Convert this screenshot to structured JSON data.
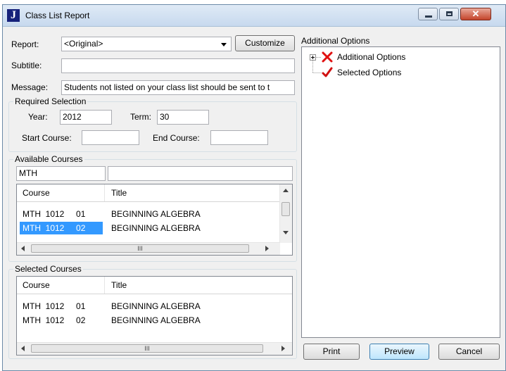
{
  "window": {
    "title": "Class List Report",
    "app_icon_letter": "J"
  },
  "form": {
    "report_label": "Report:",
    "report_value": "<Original>",
    "customize_label": "Customize",
    "subtitle_label": "Subtitle:",
    "subtitle_value": "",
    "message_label": "Message:",
    "message_value": "Students not listed on your class list should be sent to t"
  },
  "required_selection": {
    "title": "Required Selection",
    "year_label": "Year:",
    "year_value": "2012",
    "term_label": "Term:",
    "term_value": "30",
    "start_course_label": "Start Course:",
    "start_course_value": "",
    "end_course_label": "End Course:",
    "end_course_value": ""
  },
  "available_courses": {
    "title": "Available Courses",
    "filter_course": "MTH",
    "filter_title": "",
    "columns": [
      "Course",
      "Title"
    ],
    "rows": [
      {
        "course": "MTH  1012     01",
        "title": "BEGINNING ALGEBRA",
        "selected": false
      },
      {
        "course": "MTH  1012     02",
        "title": "BEGINNING ALGEBRA",
        "selected": true
      }
    ],
    "scroll_grip": "III"
  },
  "selected_courses": {
    "title": "Selected Courses",
    "columns": [
      "Course",
      "Title"
    ],
    "rows": [
      {
        "course": "MTH  1012     01",
        "title": "BEGINNING ALGEBRA"
      },
      {
        "course": "MTH  1012     02",
        "title": "BEGINNING ALGEBRA"
      }
    ],
    "scroll_grip": "III"
  },
  "additional_options": {
    "title": "Additional Options",
    "tree": [
      {
        "label": "Additional Options",
        "icon": "red-x-icon",
        "expand": "+"
      },
      {
        "label": "Selected Options",
        "icon": "red-checkmark-icon"
      }
    ]
  },
  "buttons": {
    "print": "Print",
    "preview": "Preview",
    "cancel": "Cancel"
  },
  "colors": {
    "selection": "#3399ff",
    "title_icon": "#16217a",
    "close": "#c4442b"
  }
}
